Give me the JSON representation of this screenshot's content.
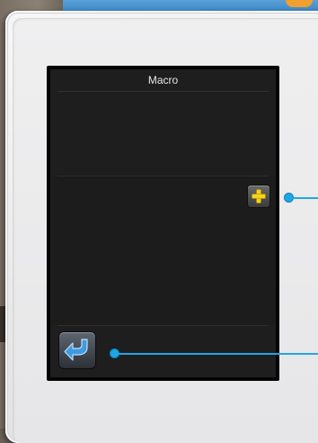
{
  "screen": {
    "title": "Macro"
  },
  "icons": {
    "add": "plus-icon",
    "back": "return-arrow-icon"
  },
  "colors": {
    "screen_background": "#1e1e1e",
    "plus_yellow": "#f6d21a",
    "callout_blue": "#1ea7e6",
    "arrow_blue": "#3f9be0"
  }
}
